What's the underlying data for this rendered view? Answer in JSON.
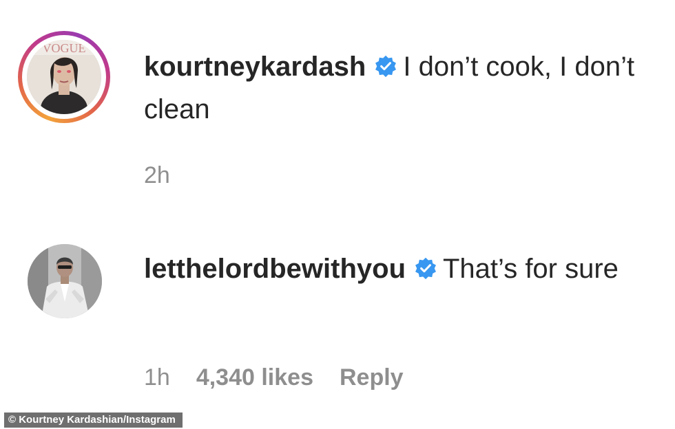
{
  "comments": [
    {
      "username": "kourtneykardash",
      "verified": true,
      "text": "I don’t cook, I don’t clean",
      "time": "2h",
      "avatar": "profile-photo-with-story-ring"
    },
    {
      "username": "letthelordbewithyou",
      "verified": true,
      "text": "That’s for sure",
      "time": "1h",
      "likes": "4,340 likes",
      "reply_label": "Reply",
      "avatar": "profile-photo"
    }
  ],
  "credit": "© Kourtney Kardashian/Instagram",
  "colors": {
    "text": "#262626",
    "muted": "#8e8e8e",
    "verified_blue": "#3897f0",
    "story_ring": [
      "#f3a33b",
      "#e2654a",
      "#c03a8c",
      "#9a3bb0"
    ]
  },
  "icons": {
    "verified": "verified-badge-icon"
  }
}
